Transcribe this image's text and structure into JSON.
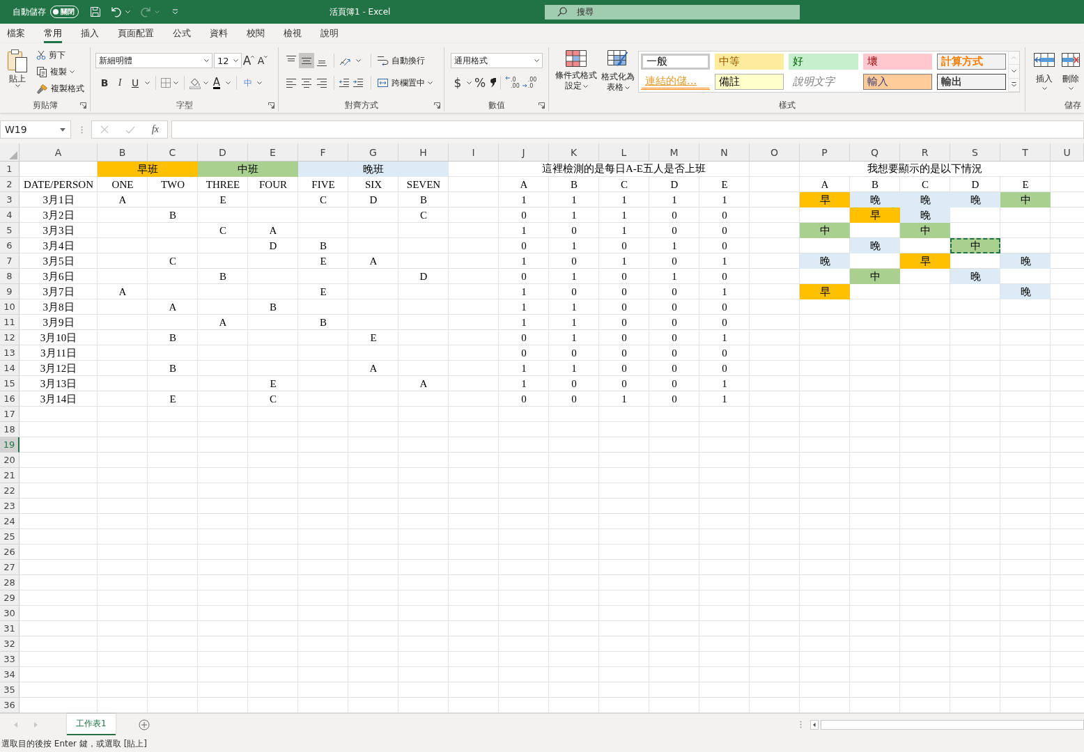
{
  "title_bar": {
    "autosave": {
      "label": "自動儲存",
      "state_label": "關閉",
      "on": false
    },
    "quick_access": [
      {
        "kind": "save",
        "disabled": false
      },
      {
        "kind": "undo",
        "disabled": false
      },
      {
        "kind": "redo",
        "disabled": true
      },
      {
        "kind": "customize",
        "disabled": false
      }
    ],
    "title": "活頁簿1 - Excel",
    "search": {
      "placeholder": "搜尋"
    }
  },
  "ribbon_tabs": [
    {
      "label": "檔案",
      "selected": false
    },
    {
      "label": "常用",
      "selected": true
    },
    {
      "label": "插入",
      "selected": false
    },
    {
      "label": "頁面配置",
      "selected": false
    },
    {
      "label": "公式",
      "selected": false
    },
    {
      "label": "資料",
      "selected": false
    },
    {
      "label": "校閱",
      "selected": false
    },
    {
      "label": "檢視",
      "selected": false
    },
    {
      "label": "說明",
      "selected": false
    }
  ],
  "ribbon": {
    "clipboard": {
      "paste": "貼上",
      "cut": "剪下",
      "copy": "複製",
      "format_painter": "複製格式",
      "label": "剪貼簿"
    },
    "font": {
      "font_name": "新細明體",
      "font_size": "12",
      "grow": "A",
      "shrink": "A",
      "bold": "B",
      "italic": "I",
      "underline": "U",
      "font_color": "A",
      "phonetic": "中",
      "label": "字型"
    },
    "alignment": {
      "vertical": [
        {
          "kind": "top",
          "selected": false
        },
        {
          "kind": "middle",
          "selected": true
        },
        {
          "kind": "bottom",
          "selected": false
        }
      ],
      "horizontal": [
        {
          "kind": "left",
          "selected": false
        },
        {
          "kind": "center",
          "selected": false
        },
        {
          "kind": "right",
          "selected": false
        }
      ],
      "wrap_text": "自動換行",
      "merge_center": "跨欄置中",
      "label": "對齊方式"
    },
    "number": {
      "format": "通用格式",
      "currency": "$",
      "percent": "%",
      "decimals": [
        {
          "kind": "increase",
          "top": ".0",
          "bottom": ".00"
        },
        {
          "kind": "decrease",
          "top": ".00",
          "bottom": ".0"
        }
      ],
      "label": "數值"
    },
    "styles": {
      "conditional_formatting": "條件式格式設定",
      "format_as_table": "格式化為表格",
      "gallery": [
        {
          "label": "一般",
          "kind": "normal",
          "selected": true
        },
        {
          "label": "中等",
          "kind": "neutral",
          "selected": false
        },
        {
          "label": "好",
          "kind": "good",
          "selected": false
        },
        {
          "label": "壞",
          "kind": "bad",
          "selected": false
        },
        {
          "label": "計算方式",
          "kind": "calculation",
          "selected": false
        },
        {
          "label": "連結的儲...",
          "kind": "linked",
          "selected": false
        },
        {
          "label": "備註",
          "kind": "note",
          "selected": false
        },
        {
          "label": "說明文字",
          "kind": "explanatory",
          "selected": false
        },
        {
          "label": "輸入",
          "kind": "input",
          "selected": false
        },
        {
          "label": "輸出",
          "kind": "output",
          "selected": false
        }
      ],
      "gallery_controls": [
        {
          "kind": "up",
          "disabled": true
        },
        {
          "kind": "down",
          "disabled": false
        },
        {
          "kind": "more",
          "disabled": false
        }
      ],
      "label": "樣式"
    },
    "cells": {
      "insert": "插入",
      "delete": "刪除",
      "label": "儲存"
    }
  },
  "formula_bar": {
    "name_box": "W19",
    "insert_function": "fx",
    "editing": false
  },
  "sheet": {
    "column_headers": [
      {
        "label": "A",
        "selected": false
      },
      {
        "label": "B",
        "selected": false
      },
      {
        "label": "C",
        "selected": false
      },
      {
        "label": "D",
        "selected": false
      },
      {
        "label": "E",
        "selected": false
      },
      {
        "label": "F",
        "selected": false
      },
      {
        "label": "G",
        "selected": false
      },
      {
        "label": "H",
        "selected": false
      },
      {
        "label": "I",
        "selected": false
      },
      {
        "label": "J",
        "selected": false
      },
      {
        "label": "K",
        "selected": false
      },
      {
        "label": "L",
        "selected": false
      },
      {
        "label": "M",
        "selected": false
      },
      {
        "label": "N",
        "selected": false
      },
      {
        "label": "O",
        "selected": false
      },
      {
        "label": "P",
        "selected": false
      },
      {
        "label": "Q",
        "selected": false
      },
      {
        "label": "R",
        "selected": false
      },
      {
        "label": "S",
        "selected": false
      },
      {
        "label": "T",
        "selected": false
      },
      {
        "label": "U",
        "selected": false
      }
    ],
    "row_headers": [
      {
        "label": "1",
        "selected": false
      },
      {
        "label": "2",
        "selected": false
      },
      {
        "label": "3",
        "selected": false
      },
      {
        "label": "4",
        "selected": false
      },
      {
        "label": "5",
        "selected": false
      },
      {
        "label": "6",
        "selected": false
      },
      {
        "label": "7",
        "selected": false
      },
      {
        "label": "8",
        "selected": false
      },
      {
        "label": "9",
        "selected": false
      },
      {
        "label": "10",
        "selected": false
      },
      {
        "label": "11",
        "selected": false
      },
      {
        "label": "12",
        "selected": false
      },
      {
        "label": "13",
        "selected": false
      },
      {
        "label": "14",
        "selected": false
      },
      {
        "label": "15",
        "selected": false
      },
      {
        "label": "16",
        "selected": false
      },
      {
        "label": "17",
        "selected": false
      },
      {
        "label": "18",
        "selected": false
      },
      {
        "label": "19",
        "selected": true
      },
      {
        "label": "20",
        "selected": false
      },
      {
        "label": "21",
        "selected": false
      },
      {
        "label": "22",
        "selected": false
      },
      {
        "label": "23",
        "selected": false
      },
      {
        "label": "24",
        "selected": false
      },
      {
        "label": "25",
        "selected": false
      },
      {
        "label": "26",
        "selected": false
      },
      {
        "label": "27",
        "selected": false
      },
      {
        "label": "28",
        "selected": false
      },
      {
        "label": "29",
        "selected": false
      },
      {
        "label": "30",
        "selected": false
      },
      {
        "label": "31",
        "selected": false
      },
      {
        "label": "32",
        "selected": false
      },
      {
        "label": "33",
        "selected": false
      },
      {
        "label": "34",
        "selected": false
      },
      {
        "label": "35",
        "selected": false
      },
      {
        "label": "36",
        "selected": false
      }
    ],
    "schedule": {
      "groups": [
        {
          "label": "早班",
          "color": "#ffc000",
          "slots": [
            "ONE",
            "TWO"
          ]
        },
        {
          "label": "中班",
          "color": "#a9d08e",
          "slots": [
            "THREE",
            "FOUR"
          ]
        },
        {
          "label": "晚班",
          "color": "#ddebf7",
          "slots": [
            "FIVE",
            "SIX",
            "SEVEN"
          ]
        }
      ],
      "corner": "DATE/PERSON",
      "rows": [
        {
          "date": "3月1日",
          "slot_1": "A",
          "slot_3": "E",
          "slot_5": "C",
          "slot_6": "D",
          "slot_7": "B"
        },
        {
          "date": "3月2日",
          "slot_2": "B",
          "slot_7": "C"
        },
        {
          "date": "3月3日",
          "slot_3": "C",
          "slot_4": "A"
        },
        {
          "date": "3月4日",
          "slot_4": "D",
          "slot_5": "B"
        },
        {
          "date": "3月5日",
          "slot_2": "C",
          "slot_5": "E",
          "slot_6": "A"
        },
        {
          "date": "3月6日",
          "slot_3": "B",
          "slot_7": "D"
        },
        {
          "date": "3月7日",
          "slot_1": "A",
          "slot_5": "E"
        },
        {
          "date": "3月8日",
          "slot_2": "A",
          "slot_4": "B"
        },
        {
          "date": "3月9日",
          "slot_3": "A",
          "slot_5": "B"
        },
        {
          "date": "3月10日",
          "slot_2": "B",
          "slot_6": "E"
        },
        {
          "date": "3月11日"
        },
        {
          "date": "3月12日",
          "slot_2": "B",
          "slot_6": "A"
        },
        {
          "date": "3月13日",
          "slot_4": "E",
          "slot_7": "A"
        },
        {
          "date": "3月14日",
          "slot_2": "E",
          "slot_4": "C"
        }
      ]
    },
    "check_table": {
      "title": "這裡檢測的是每日A-E五人是否上班",
      "people": [
        "A",
        "B",
        "C",
        "D",
        "E"
      ],
      "rows": [
        {
          "values": [
            "1",
            "1",
            "1",
            "1",
            "1"
          ]
        },
        {
          "values": [
            "0",
            "1",
            "1",
            "0",
            "0"
          ]
        },
        {
          "values": [
            "1",
            "0",
            "1",
            "0",
            "0"
          ]
        },
        {
          "values": [
            "0",
            "1",
            "0",
            "1",
            "0"
          ]
        },
        {
          "values": [
            "1",
            "0",
            "1",
            "0",
            "1"
          ]
        },
        {
          "values": [
            "0",
            "1",
            "0",
            "1",
            "0"
          ]
        },
        {
          "values": [
            "1",
            "0",
            "0",
            "0",
            "1"
          ]
        },
        {
          "values": [
            "1",
            "1",
            "0",
            "0",
            "0"
          ]
        },
        {
          "values": [
            "1",
            "1",
            "0",
            "0",
            "0"
          ]
        },
        {
          "values": [
            "0",
            "1",
            "0",
            "0",
            "1"
          ]
        },
        {
          "values": [
            "0",
            "0",
            "0",
            "0",
            "0"
          ]
        },
        {
          "values": [
            "1",
            "1",
            "0",
            "0",
            "0"
          ]
        },
        {
          "values": [
            "1",
            "0",
            "0",
            "0",
            "1"
          ]
        },
        {
          "values": [
            "0",
            "0",
            "1",
            "0",
            "1"
          ]
        }
      ]
    },
    "result_table": {
      "title": "我想要顯示的是以下情況",
      "people": [
        "A",
        "B",
        "C",
        "D",
        "E"
      ],
      "rows": [
        {
          "person_1": {
            "text": "早",
            "color": "#ffc000",
            "copied": false
          },
          "person_2": {
            "text": "晚",
            "color": "#ddebf7",
            "copied": false
          },
          "person_3": {
            "text": "晚",
            "color": "#ddebf7",
            "copied": false
          },
          "person_4": {
            "text": "晚",
            "color": "#ddebf7",
            "copied": false
          },
          "person_5": {
            "text": "中",
            "color": "#a9d08e",
            "copied": false
          }
        },
        {
          "person_2": {
            "text": "早",
            "color": "#ffc000",
            "copied": false
          },
          "person_3": {
            "text": "晚",
            "color": "#ddebf7",
            "copied": false
          }
        },
        {
          "person_1": {
            "text": "中",
            "color": "#a9d08e",
            "copied": false
          },
          "person_3": {
            "text": "中",
            "color": "#a9d08e",
            "copied": false
          }
        },
        {
          "person_2": {
            "text": "晚",
            "color": "#ddebf7",
            "copied": false
          },
          "person_4": {
            "text": "中",
            "color": "#a9d08e",
            "copied": true
          }
        },
        {
          "person_1": {
            "text": "晚",
            "color": "#ddebf7",
            "copied": false
          },
          "person_3": {
            "text": "早",
            "color": "#ffc000",
            "copied": false
          },
          "person_5": {
            "text": "晚",
            "color": "#ddebf7",
            "copied": false
          }
        },
        {
          "person_2": {
            "text": "中",
            "color": "#a9d08e",
            "copied": false
          },
          "person_4": {
            "text": "晚",
            "color": "#ddebf7",
            "copied": false
          }
        },
        {
          "person_1": {
            "text": "早",
            "color": "#ffc000",
            "copied": false
          },
          "person_5": {
            "text": "晚",
            "color": "#ddebf7",
            "copied": false
          }
        }
      ]
    }
  },
  "sheet_tabs": {
    "nav": [
      {
        "kind": "previous",
        "disabled": true
      },
      {
        "kind": "next",
        "disabled": true
      }
    ],
    "tabs": [
      {
        "label": "工作表1",
        "selected": true
      }
    ]
  },
  "status_bar": {
    "message": "選取目的後按 Enter 鍵，或選取 [貼上]"
  }
}
